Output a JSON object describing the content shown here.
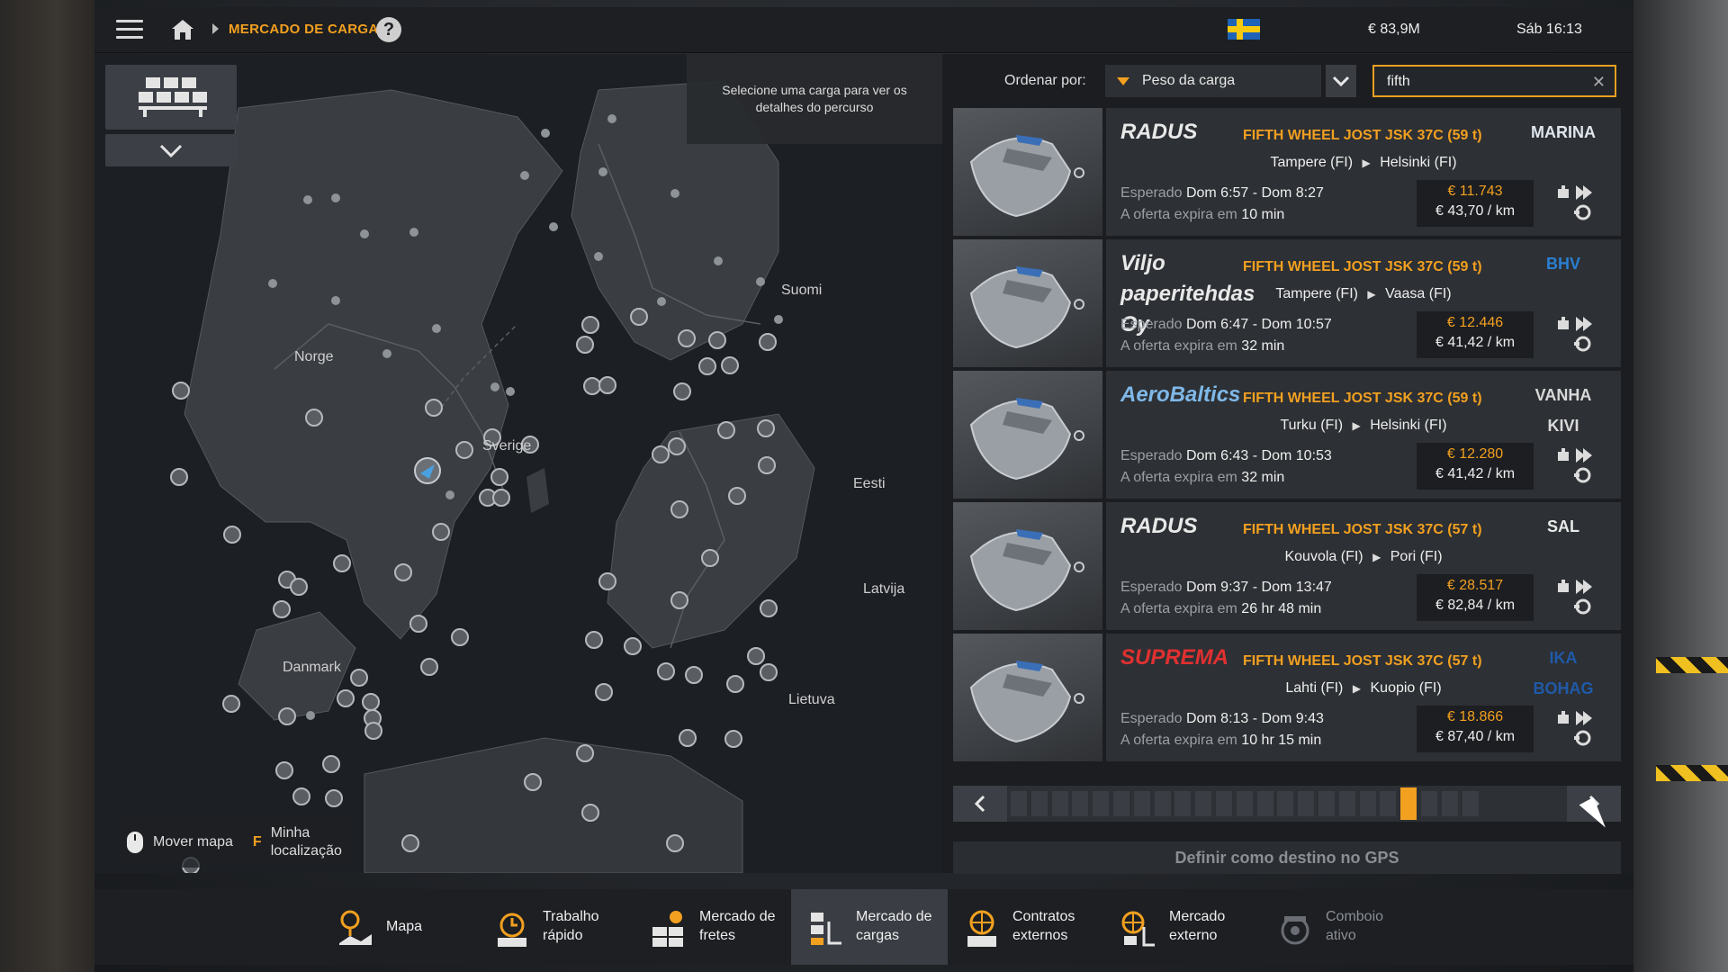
{
  "topbar": {
    "breadcrumb": "MERCADO DE CARGAS",
    "help": "?",
    "money": "€ 83,9M",
    "time": "Sáb 16:13"
  },
  "map": {
    "hint": "Selecione uma carga para ver os detalhes do percurso",
    "labels": {
      "norge": "Norge",
      "sverige": "Sverige",
      "suomi": "Suomi",
      "eesti": "Eesti",
      "latvija": "Latvija",
      "lietuva": "Lietuva",
      "danmark": "Danmark"
    },
    "legend": {
      "move": "Mover mapa",
      "key": "F",
      "location_line1": "Minha",
      "location_line2": "localização"
    }
  },
  "sort": {
    "label": "Ordenar por:",
    "value": "Peso da carga"
  },
  "search": {
    "value": "fifth"
  },
  "offers": [
    {
      "sender": "RADUS",
      "receiver": "MARINA",
      "cargo": "FIFTH WHEEL JOST JSK 37C (59 t)",
      "from": "Tampere (FI)",
      "to": "Helsinki (FI)",
      "expected_label": "Esperado",
      "expected": "Dom 6:57 - Dom 8:27",
      "expires_label": "A oferta expira em",
      "expires": "10 min",
      "price": "€ 11.743",
      "per_km": "€ 43,70 / km"
    },
    {
      "sender": "Viljo paperitehdas Oy",
      "receiver": "BHV",
      "cargo": "FIFTH WHEEL JOST JSK 37C (59 t)",
      "from": "Tampere (FI)",
      "to": "Vaasa (FI)",
      "expected_label": "Esperado",
      "expected": "Dom 6:47 - Dom 10:57",
      "expires_label": "A oferta expira em",
      "expires": "32 min",
      "price": "€ 12.446",
      "per_km": "€ 41,42 / km"
    },
    {
      "sender": "AeroBaltics",
      "receiver": "VANHA KIVI",
      "cargo": "FIFTH WHEEL JOST JSK 37C (59 t)",
      "from": "Turku (FI)",
      "to": "Helsinki (FI)",
      "expected_label": "Esperado",
      "expected": "Dom 6:43 - Dom 10:53",
      "expires_label": "A oferta expira em",
      "expires": "32 min",
      "price": "€ 12.280",
      "per_km": "€ 41,42 / km"
    },
    {
      "sender": "RADUS",
      "receiver": "SAL",
      "cargo": "FIFTH WHEEL JOST JSK 37C (57 t)",
      "from": "Kouvola (FI)",
      "to": "Pori (FI)",
      "expected_label": "Esperado",
      "expected": "Dom 9:37 - Dom 13:47",
      "expires_label": "A oferta expira em",
      "expires": "26 hr 48 min",
      "price": "€ 28.517",
      "per_km": "€ 82,84 / km"
    },
    {
      "sender": "SUPREMA",
      "receiver": "IKA BOHAG",
      "cargo": "FIFTH WHEEL JOST JSK 37C (57 t)",
      "from": "Lahti (FI)",
      "to": "Kuopio (FI)",
      "expected_label": "Esperado",
      "expected": "Dom 8:13 - Dom 9:43",
      "expires_label": "A oferta expira em",
      "expires": "10 hr 15 min",
      "price": "€ 18.866",
      "per_km": "€ 87,40 / km"
    }
  ],
  "pager": {
    "total_pages": 23,
    "current_page": 20
  },
  "gps_button": "Definir como destino no GPS",
  "nav": [
    {
      "line1": "Mapa",
      "line2": ""
    },
    {
      "line1": "Trabalho",
      "line2": "rápido"
    },
    {
      "line1": "Mercado de",
      "line2": "fretes"
    },
    {
      "line1": "Mercado de",
      "line2": "cargas"
    },
    {
      "line1": "Contratos",
      "line2": "externos"
    },
    {
      "line1": "Mercado",
      "line2": "externo"
    },
    {
      "line1": "Comboio",
      "line2": "ativo"
    }
  ],
  "colors": {
    "accent": "#f2a020",
    "panel": "#2d3034",
    "background": "#1b1d20"
  }
}
